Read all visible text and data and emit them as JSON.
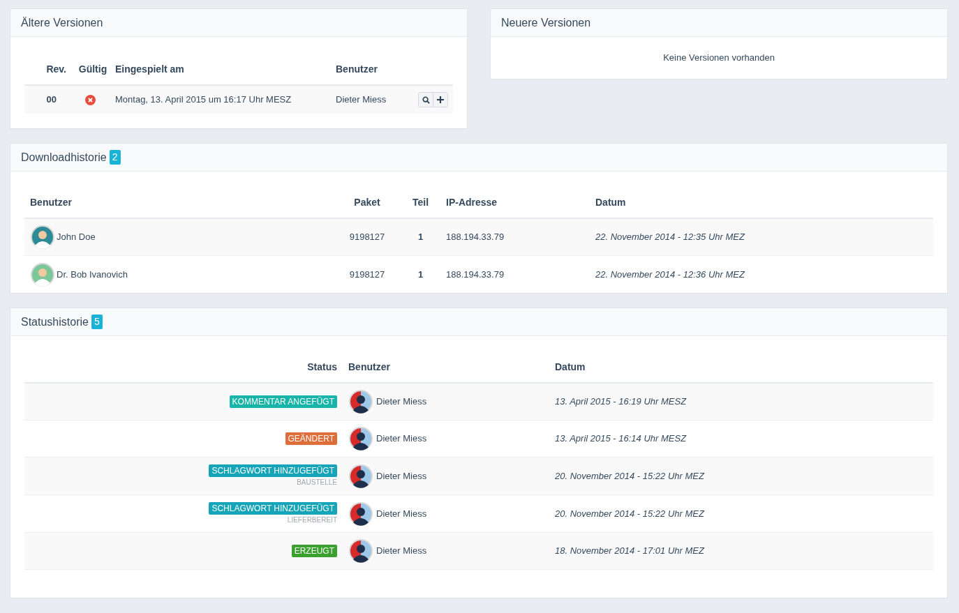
{
  "older_versions": {
    "title": "Ältere Versionen",
    "columns": [
      "Rev.",
      "Gültig",
      "Eingespielt am",
      "Benutzer"
    ],
    "rows": [
      {
        "rev": "00",
        "valid": false,
        "date": "Montag, 13. April 2015 um 16:17 Uhr MESZ",
        "user": "Dieter Miess"
      }
    ]
  },
  "newer_versions": {
    "title": "Neuere Versionen",
    "empty_text": "Keine Versionen vorhanden"
  },
  "download_history": {
    "title": "Downloadhistorie",
    "count": "2",
    "columns": [
      "Benutzer",
      "Paket",
      "Teil",
      "IP-Adresse",
      "Datum"
    ],
    "rows": [
      {
        "user": "John Doe",
        "color": "#2e8a97",
        "package": "9198127",
        "part": "1",
        "ip": "188.194.33.79",
        "date": "22. November 2014 - 12:35 Uhr MEZ"
      },
      {
        "user": "Dr. Bob Ivanovich",
        "color": "#7cc79a",
        "package": "9198127",
        "part": "1",
        "ip": "188.194.33.79",
        "date": "22. November 2014 - 12:36 Uhr MEZ"
      }
    ]
  },
  "status_history": {
    "title": "Statushistorie",
    "count": "5",
    "columns": [
      "Status",
      "Benutzer",
      "Datum"
    ],
    "rows": [
      {
        "status": "KOMMENTAR ANGEFÜGT",
        "color": "#17b5a9",
        "user": "Dieter Miess",
        "date": "13. April 2015 - 16:19 Uhr MESZ"
      },
      {
        "status": "GEÄNDERT",
        "color": "#dd6e3a",
        "user": "Dieter Miess",
        "date": "13. April 2015 - 16:14 Uhr MESZ"
      },
      {
        "status": "SCHLAGWORT HINZUGEFÜGT",
        "color": "#16a4b8",
        "tag": "BAUSTELLE",
        "user": "Dieter Miess",
        "date": "20. November 2014 - 15:22 Uhr MEZ"
      },
      {
        "status": "SCHLAGWORT HINZUGEFÜGT",
        "color": "#16a4b8",
        "tag": "LIEFERBEREIT",
        "user": "Dieter Miess",
        "date": "20. November 2014 - 15:22 Uhr MEZ"
      },
      {
        "status": "ERZEUGT",
        "color": "#3aa12f",
        "user": "Dieter Miess",
        "date": "18. November 2014 - 17:01 Uhr MEZ"
      }
    ]
  }
}
